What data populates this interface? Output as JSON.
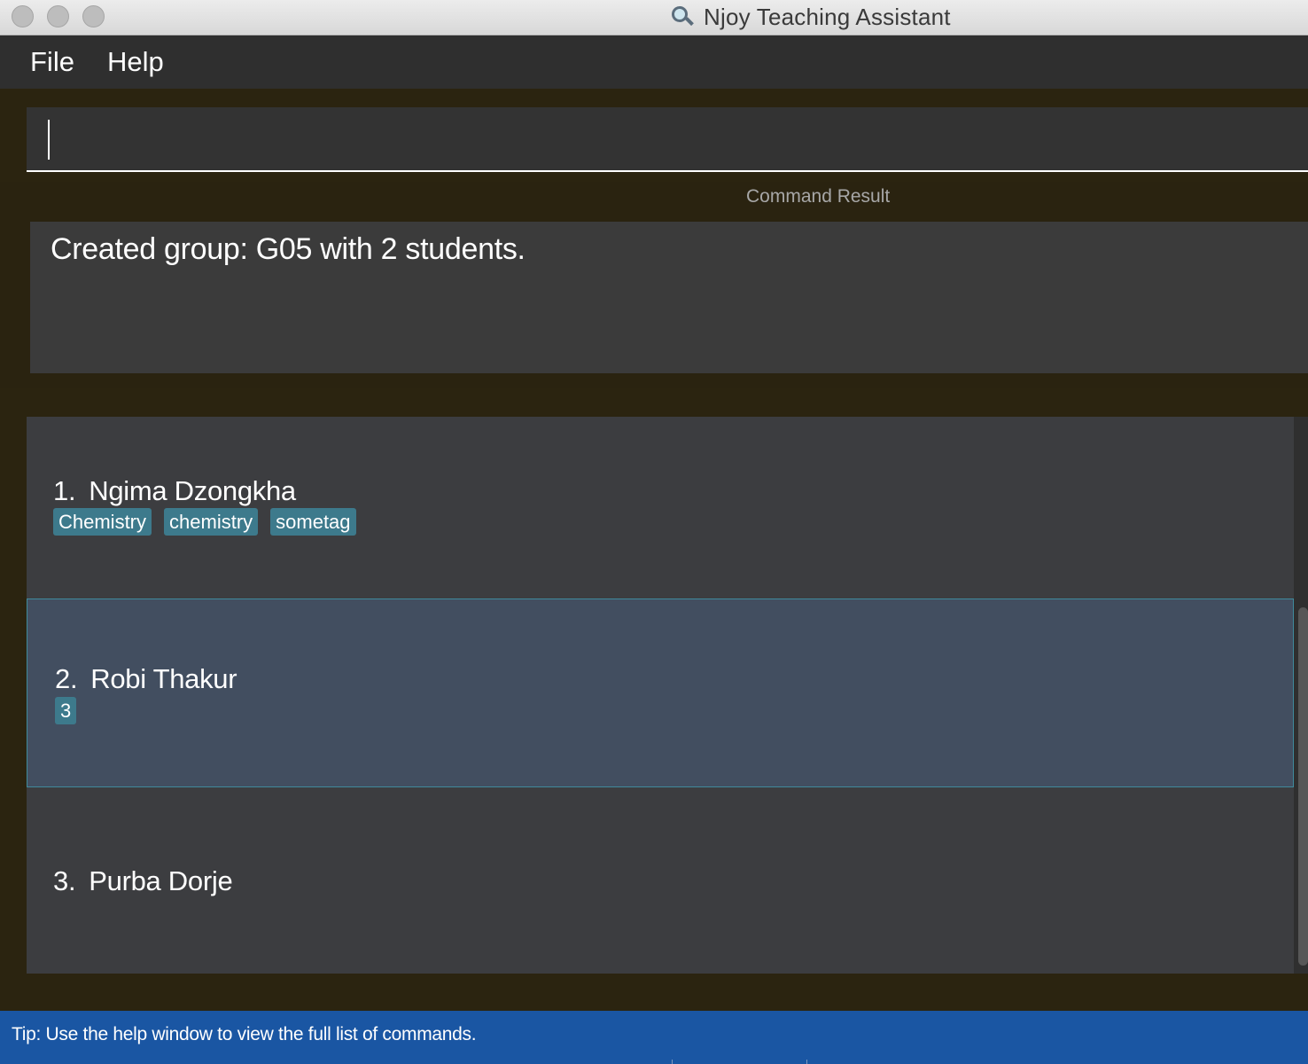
{
  "window": {
    "title": "Njoy Teaching Assistant"
  },
  "menu": {
    "items": [
      "File",
      "Help"
    ]
  },
  "command_box": {
    "value": "",
    "placeholder": ""
  },
  "result": {
    "label": "Command Result",
    "message": "Created group: G05 with 2 students."
  },
  "students": [
    {
      "index": "1.",
      "name": "Ngima Dzongkha",
      "tags": [
        "Chemistry",
        "chemistry",
        "sometag"
      ],
      "selected": false
    },
    {
      "index": "2.",
      "name": "Robi Thakur",
      "tags": [
        "3"
      ],
      "selected": true
    },
    {
      "index": "3.",
      "name": "Purba Dorje",
      "tags": [],
      "selected": false
    }
  ],
  "status": {
    "tip": "Tip: Use the help window to view the full list of commands."
  },
  "colors": {
    "accent_tag": "#3d7a8c",
    "selected_row": "#424e60",
    "status_bar": "#1a56a3",
    "background": "#2b2410"
  }
}
